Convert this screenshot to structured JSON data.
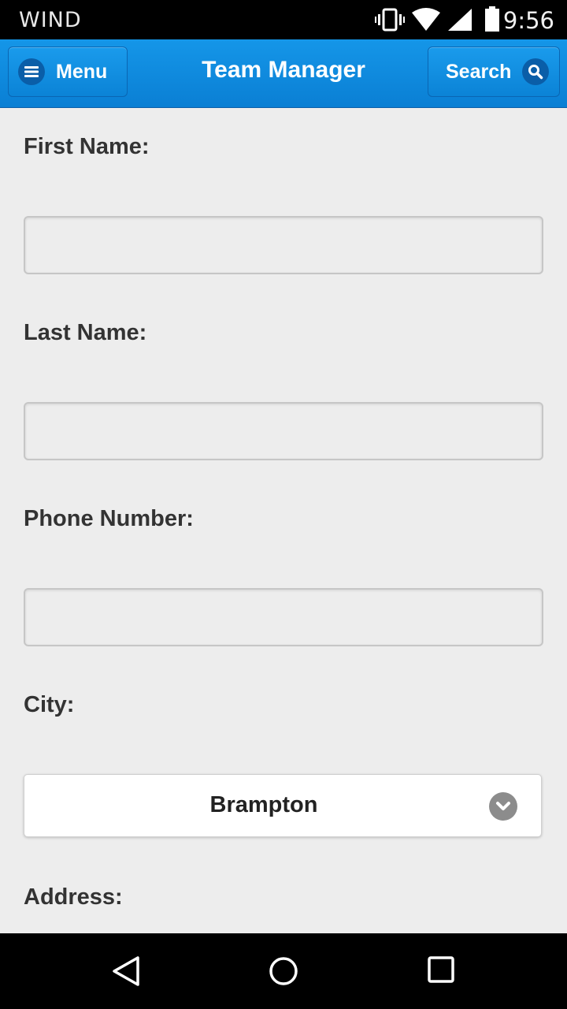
{
  "status_bar": {
    "carrier": "WIND",
    "time": "9:56",
    "icons": [
      "vibrate-icon",
      "wifi-icon",
      "signal-icon",
      "battery-icon"
    ]
  },
  "header": {
    "menu_label": "Menu",
    "title": "Team Manager",
    "search_label": "Search",
    "accent_color": "#0a85d8"
  },
  "form": {
    "first_name": {
      "label": "First Name:",
      "value": ""
    },
    "last_name": {
      "label": "Last Name:",
      "value": ""
    },
    "phone": {
      "label": "Phone Number:",
      "value": ""
    },
    "city": {
      "label": "City:",
      "selected": "Brampton"
    },
    "address": {
      "label": "Address:"
    }
  },
  "nav_bar": {
    "icons": [
      "back-icon",
      "home-icon",
      "recents-icon"
    ]
  }
}
